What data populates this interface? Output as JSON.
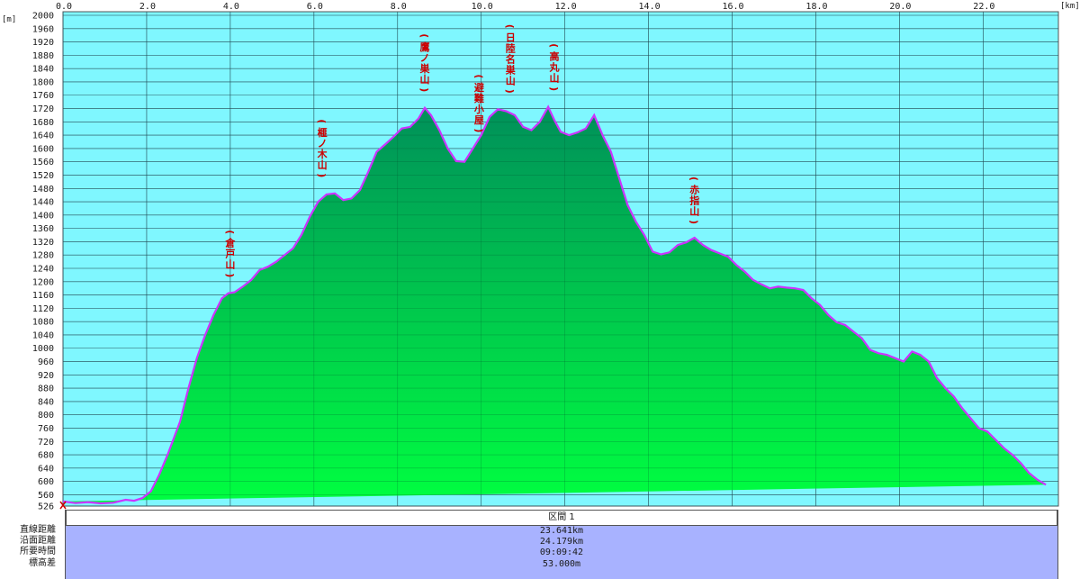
{
  "chart_data": {
    "type": "area",
    "xlabel": "",
    "ylabel": "",
    "x_unit": "[km]",
    "y_unit": "[m]",
    "xlim": [
      0,
      23.8
    ],
    "ylim": [
      526,
      2000
    ],
    "x_ticks": [
      "0.0",
      "2.0",
      "4.0",
      "6.0",
      "8.0",
      "10.0",
      "12.0",
      "14.0",
      "16.0",
      "18.0",
      "20.0",
      "22.0"
    ],
    "y_ticks": [
      "2000",
      "1960",
      "1920",
      "1880",
      "1840",
      "1800",
      "1760",
      "1720",
      "1680",
      "1640",
      "1600",
      "1560",
      "1520",
      "1480",
      "1440",
      "1400",
      "1360",
      "1320",
      "1280",
      "1240",
      "1200",
      "1160",
      "1120",
      "1080",
      "1040",
      "1000",
      "960",
      "920",
      "880",
      "840",
      "800",
      "760",
      "720",
      "680",
      "640",
      "600",
      "560",
      "526"
    ],
    "grid": true,
    "colors": {
      "background": "#7ff7ff",
      "fill_top": "#00905a",
      "fill_bottom": "#00ff40",
      "line": "#cc33ff",
      "peak_label": "#cc0000"
    },
    "x": [
      0,
      0.3,
      0.6,
      0.9,
      1.2,
      1.5,
      1.7,
      1.9,
      2.1,
      2.3,
      2.5,
      2.8,
      3.0,
      3.2,
      3.4,
      3.6,
      3.8,
      3.95,
      4.1,
      4.3,
      4.5,
      4.7,
      4.9,
      5.1,
      5.3,
      5.5,
      5.7,
      5.9,
      6.1,
      6.3,
      6.5,
      6.7,
      6.9,
      7.1,
      7.3,
      7.5,
      7.7,
      7.9,
      8.1,
      8.3,
      8.5,
      8.65,
      8.8,
      9.0,
      9.2,
      9.4,
      9.6,
      9.8,
      10.0,
      10.2,
      10.4,
      10.6,
      10.8,
      11.0,
      11.2,
      11.4,
      11.6,
      11.75,
      11.9,
      12.1,
      12.3,
      12.5,
      12.7,
      12.9,
      13.1,
      13.3,
      13.5,
      13.7,
      13.9,
      14.1,
      14.3,
      14.5,
      14.7,
      14.9,
      15.1,
      15.3,
      15.5,
      15.7,
      15.9,
      16.1,
      16.3,
      16.5,
      16.7,
      16.9,
      17.1,
      17.3,
      17.5,
      17.7,
      17.9,
      18.1,
      18.3,
      18.5,
      18.7,
      18.9,
      19.1,
      19.3,
      19.5,
      19.7,
      19.9,
      20.1,
      20.3,
      20.5,
      20.7,
      20.9,
      21.1,
      21.3,
      21.5,
      21.7,
      21.9,
      22.1,
      22.3,
      22.5,
      22.7,
      22.9,
      23.1,
      23.3,
      23.5,
      23.7
    ],
    "y": [
      540,
      535,
      538,
      534,
      536,
      545,
      542,
      550,
      570,
      620,
      680,
      780,
      880,
      970,
      1040,
      1100,
      1150,
      1165,
      1168,
      1185,
      1205,
      1235,
      1245,
      1260,
      1280,
      1300,
      1340,
      1395,
      1440,
      1462,
      1465,
      1445,
      1450,
      1475,
      1530,
      1590,
      1612,
      1635,
      1660,
      1665,
      1690,
      1722,
      1700,
      1655,
      1600,
      1562,
      1560,
      1600,
      1640,
      1695,
      1718,
      1712,
      1700,
      1665,
      1655,
      1680,
      1725,
      1685,
      1650,
      1640,
      1648,
      1660,
      1700,
      1640,
      1590,
      1510,
      1430,
      1380,
      1340,
      1290,
      1282,
      1288,
      1310,
      1318,
      1332,
      1310,
      1295,
      1285,
      1275,
      1250,
      1230,
      1205,
      1192,
      1180,
      1185,
      1182,
      1180,
      1175,
      1150,
      1130,
      1100,
      1078,
      1070,
      1050,
      1030,
      995,
      985,
      980,
      970,
      960,
      990,
      980,
      960,
      910,
      880,
      855,
      820,
      790,
      760,
      750,
      725,
      700,
      680,
      655,
      625,
      605,
      590
    ]
  },
  "peak_labels": [
    {
      "text": "倉戸山",
      "x": 4.0,
      "y": 1165
    },
    {
      "text": "榧ノ木山",
      "x": 6.2,
      "y": 1465
    },
    {
      "text": "鷹ノ巣山",
      "x": 8.65,
      "y": 1722
    },
    {
      "text": "避難小屋",
      "x": 9.95,
      "y": 1600
    },
    {
      "text": "日陸名巣山",
      "x": 10.7,
      "y": 1718
    },
    {
      "text": "高丸山",
      "x": 11.75,
      "y": 1725
    },
    {
      "text": "赤指山",
      "x": 15.1,
      "y": 1325
    }
  ],
  "summary": {
    "column_header": "区間 1",
    "rows": [
      {
        "label": "直線距離",
        "value": "23.641km"
      },
      {
        "label": "沿面距離",
        "value": "24.179km"
      },
      {
        "label": "所要時間",
        "value": "09:09:42"
      },
      {
        "label": "標高差",
        "value": "53.000m"
      }
    ]
  }
}
